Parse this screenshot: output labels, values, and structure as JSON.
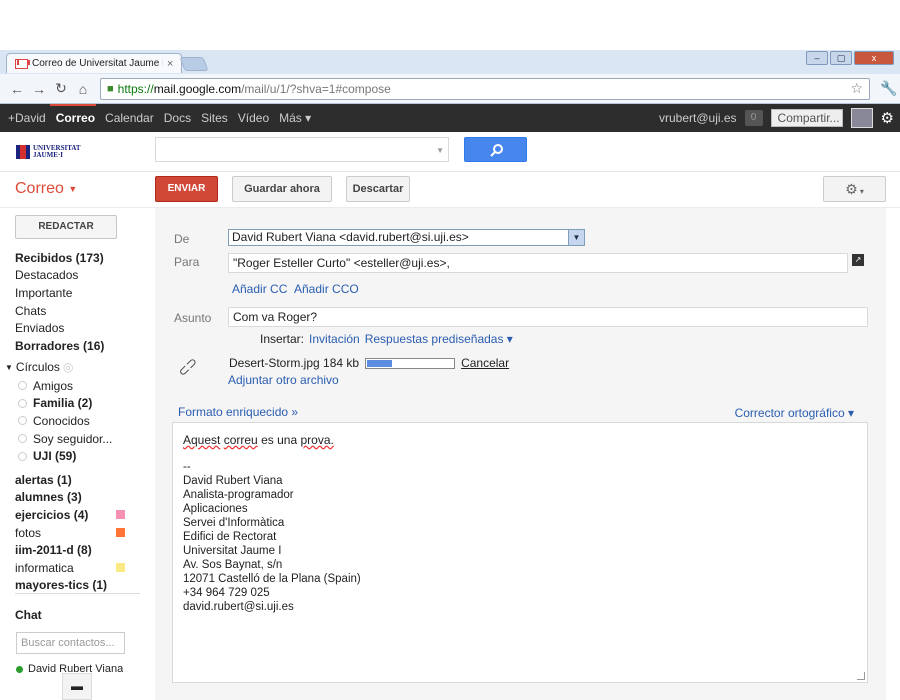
{
  "browser": {
    "tab_title": "Correo de Universitat Jaume I",
    "tab_close": "×",
    "url_secure": "https://",
    "url_host": "mail.google.com",
    "url_path": "/mail/u/1/?shva=1#compose",
    "win_min": "–",
    "win_max": "▢",
    "win_close": "x"
  },
  "gbar": {
    "items": [
      "+David",
      "Correo",
      "Calendar",
      "Docs",
      "Sites",
      "Vídeo",
      "Más ▾"
    ],
    "email": "vrubert@uji.es",
    "notifications": "0",
    "share": "Compartir..."
  },
  "logo": {
    "line1": "UNIVERSITAT",
    "line2": "JAUME·I"
  },
  "actions": {
    "app_name": "Correo",
    "send": "ENVIAR",
    "save": "Guardar ahora",
    "discard": "Descartar"
  },
  "sidebar": {
    "compose": "REDACTAR",
    "nav": [
      {
        "label": "Recibidos (173)",
        "bold": true
      },
      {
        "label": "Destacados",
        "bold": false
      },
      {
        "label": "Importante",
        "bold": false
      },
      {
        "label": "Chats",
        "bold": false
      },
      {
        "label": "Enviados",
        "bold": false
      },
      {
        "label": "Borradores (16)",
        "bold": true
      }
    ],
    "circles_title": "Círculos",
    "circles": [
      {
        "label": "Amigos",
        "bold": false
      },
      {
        "label": "Familia (2)",
        "bold": true
      },
      {
        "label": "Conocidos",
        "bold": false
      },
      {
        "label": "Soy seguidor...",
        "bold": false
      },
      {
        "label": "UJI (59)",
        "bold": true
      }
    ],
    "labels": [
      {
        "label": "alertas (1)",
        "bold": true,
        "color": ""
      },
      {
        "label": "alumnes (3)",
        "bold": true,
        "color": ""
      },
      {
        "label": "ejercicios (4)",
        "bold": true,
        "color": "#f691b2"
      },
      {
        "label": "fotos",
        "bold": false,
        "color": "#ff7537"
      },
      {
        "label": "iim-2011-d (8)",
        "bold": true,
        "color": ""
      },
      {
        "label": "informatica",
        "bold": false,
        "color": "#fbe983"
      },
      {
        "label": "mayores-tics (1)",
        "bold": true,
        "color": ""
      }
    ],
    "chat_title": "Chat",
    "contact_search_placeholder": "Buscar contactos...",
    "contact": "David Rubert Viana"
  },
  "compose": {
    "from_label": "De",
    "from_value": "David Rubert Viana <david.rubert@si.uji.es>",
    "to_label": "Para",
    "to_value": "\"Roger Esteller Curto\" <esteller@uji.es>,",
    "add_cc": "Añadir CC",
    "add_cco": "Añadir CCO",
    "subject_label": "Asunto",
    "subject_value": "Com va Roger?",
    "insert_label": "Insertar:",
    "insert_invitation": "Invitación",
    "insert_canned": "Respuestas prediseñadas ▾",
    "attachment_name": "Desert-Storm.jpg 184 kb",
    "attachment_progress": 0.28,
    "cancel": "Cancelar",
    "attach_another": "Adjuntar otro archivo",
    "rich_format": "Formato enriquecido »",
    "spell_check": "Corrector ortográfico ▾",
    "body_words": [
      "Aquest",
      "correu",
      "es",
      "una",
      "prova."
    ],
    "signature": "--\nDavid Rubert Viana\nAnalista-programador\nAplicaciones\nServei d'Informàtica\nEdifici de Rectorat\nUniversitat Jaume I\nAv. Sos Baynat, s/n\n12071 Castelló de la Plana (Spain)\n+34 964 729 025\ndavid.rubert@si.uji.es"
  }
}
